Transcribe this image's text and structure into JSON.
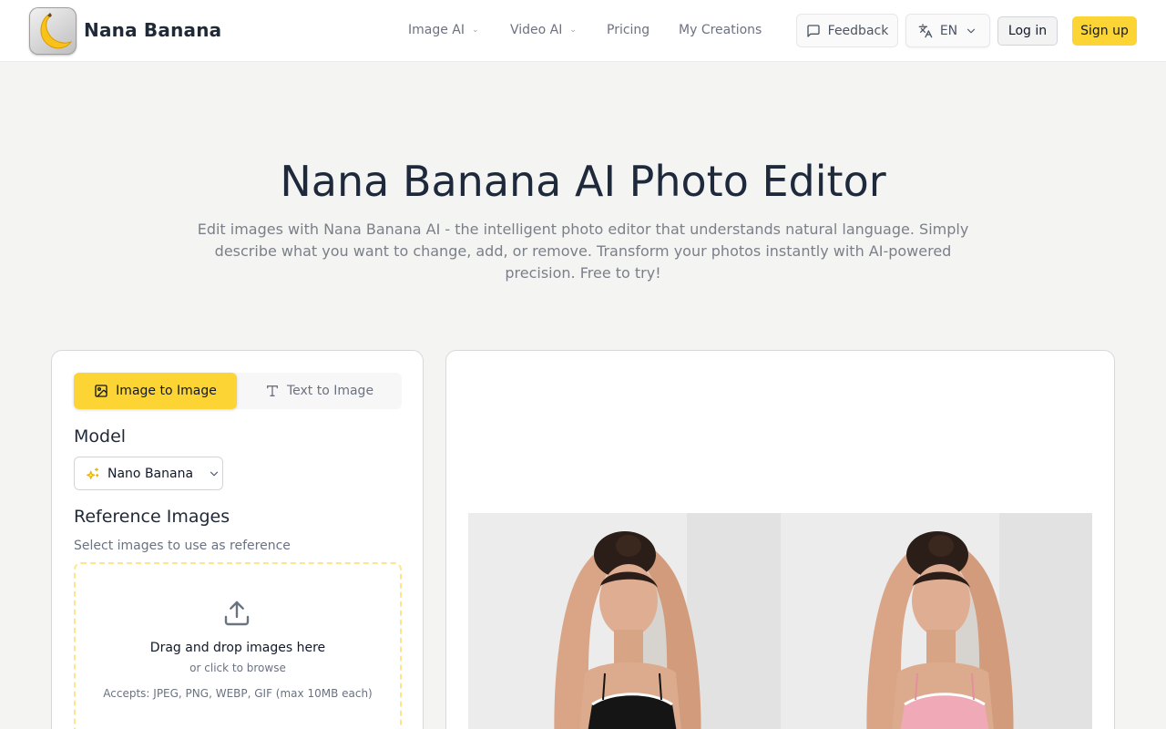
{
  "header": {
    "brand": "Nana Banana",
    "nav": [
      {
        "label": "Image AI",
        "has_dropdown": true
      },
      {
        "label": "Video AI",
        "has_dropdown": true
      },
      {
        "label": "Pricing",
        "has_dropdown": false
      },
      {
        "label": "My Creations",
        "has_dropdown": false
      }
    ],
    "feedback_label": "Feedback",
    "language": "EN",
    "login_label": "Log in",
    "signup_label": "Sign up"
  },
  "hero": {
    "title": "Nana Banana AI Photo Editor",
    "subtitle": "Edit images with Nana Banana AI - the intelligent photo editor that understands natural language. Simply describe what you want to change, add, or remove. Transform your photos instantly with AI-powered precision. Free to try!"
  },
  "editor": {
    "tabs": [
      {
        "label": "Image to Image",
        "icon": "image-icon",
        "active": true
      },
      {
        "label": "Text to Image",
        "icon": "text-icon",
        "active": false
      }
    ],
    "model_label": "Model",
    "model_value": "Nano Banana",
    "reference_label": "Reference Images",
    "reference_help": "Select images to use as reference",
    "dropzone": {
      "title": "Drag and drop images here",
      "subtitle": "or click to browse",
      "accepts": "Accepts: JPEG, PNG, WEBP, GIF (max 10MB each)"
    }
  },
  "colors": {
    "accent": "#fcd535",
    "dropzone_border": "#fde68a",
    "page_bg": "#f4f4f3"
  }
}
